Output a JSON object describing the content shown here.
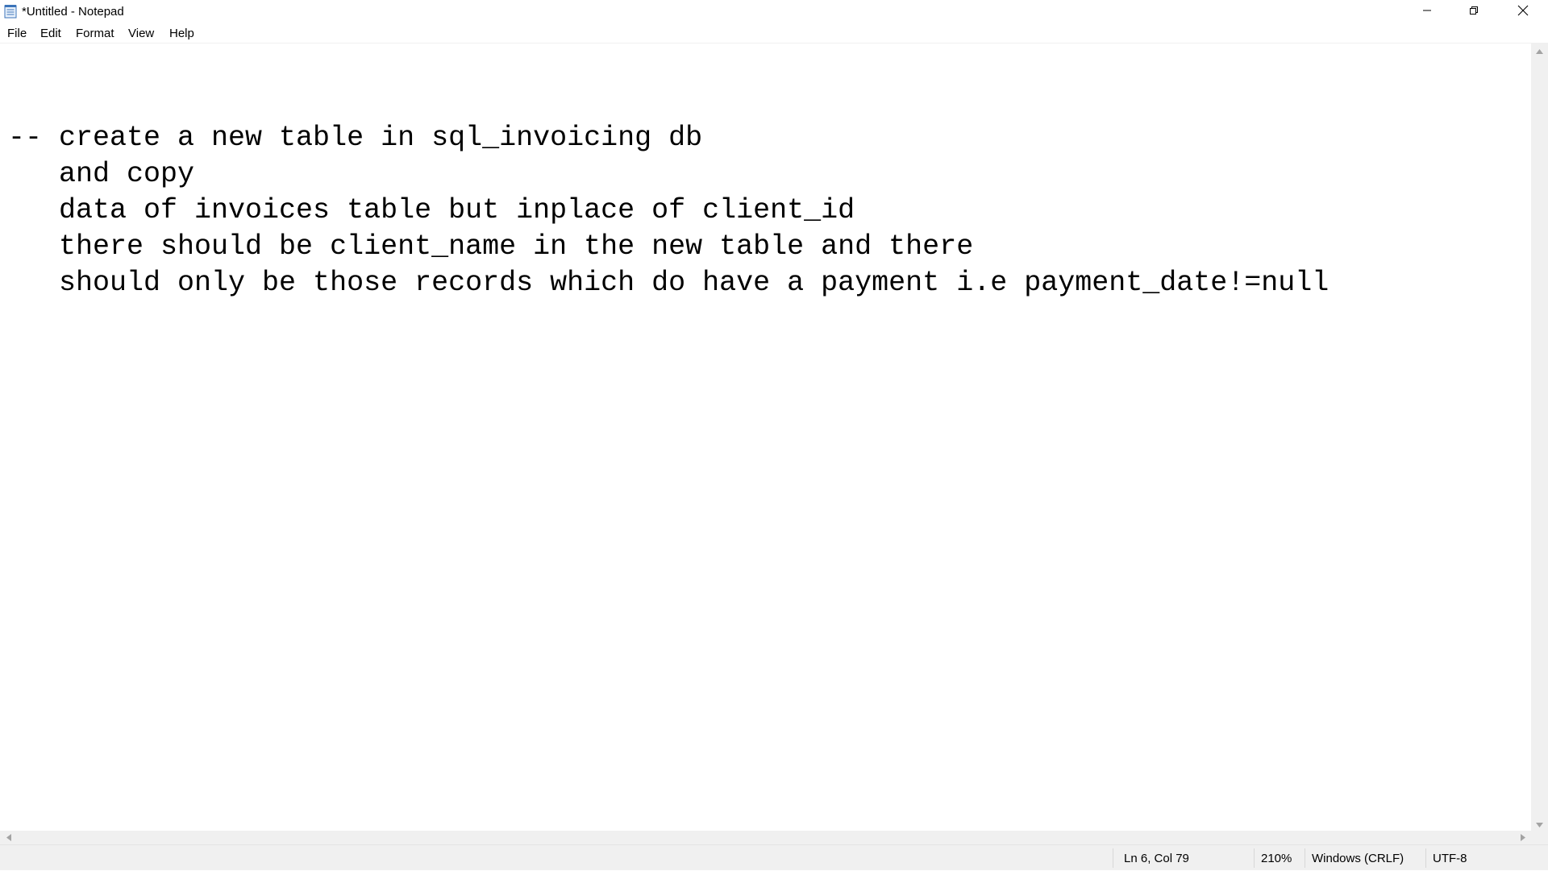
{
  "window": {
    "title": "*Untitled - Notepad"
  },
  "icons": {
    "app": "notepad-icon",
    "minimize": "minimize-icon",
    "maximize": "restore-icon",
    "close": "close-icon",
    "scroll_up": "arrow-up-icon",
    "scroll_down": "arrow-down-icon",
    "scroll_left": "arrow-left-icon",
    "scroll_right": "arrow-right-icon"
  },
  "menu": {
    "file": "File",
    "edit": "Edit",
    "format": "Format",
    "view": "View",
    "help": "Help"
  },
  "editor": {
    "content": "\n-- create a new table in sql_invoicing db\n   and copy\n   data of invoices table but inplace of client_id\n   there should be client_name in the new table and there\n   should only be those records which do have a payment i.e payment_date!=null"
  },
  "status": {
    "position": "Ln 6, Col 79",
    "zoom": "210%",
    "line_ending": "Windows (CRLF)",
    "encoding": "UTF-8"
  },
  "colors": {
    "background": "#ffffff",
    "chrome": "#f0f0f0",
    "text": "#000000"
  }
}
